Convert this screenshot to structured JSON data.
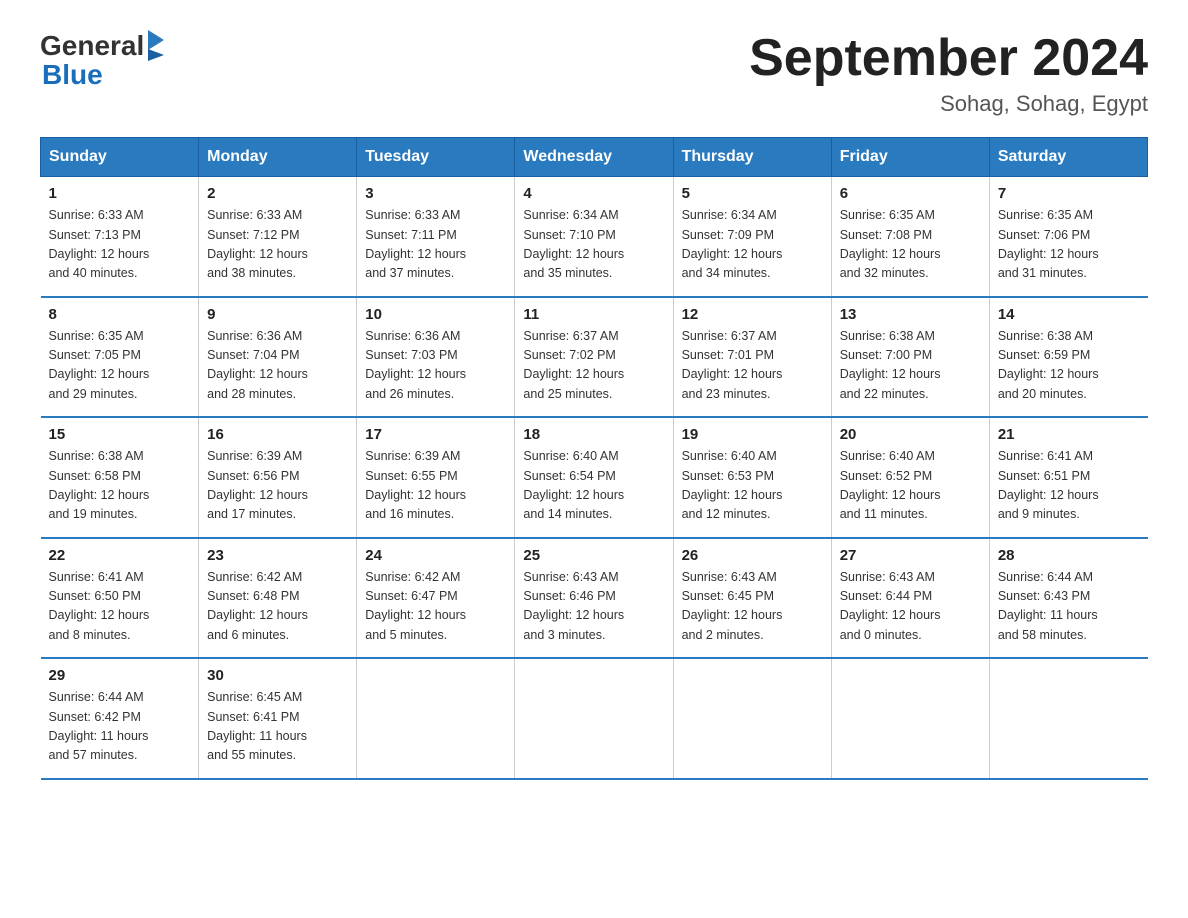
{
  "header": {
    "logo_general": "General",
    "logo_blue": "Blue",
    "title": "September 2024",
    "location": "Sohag, Sohag, Egypt"
  },
  "days_of_week": [
    "Sunday",
    "Monday",
    "Tuesday",
    "Wednesday",
    "Thursday",
    "Friday",
    "Saturday"
  ],
  "weeks": [
    [
      {
        "day": "1",
        "sunrise": "6:33 AM",
        "sunset": "7:13 PM",
        "daylight": "12 hours and 40 minutes."
      },
      {
        "day": "2",
        "sunrise": "6:33 AM",
        "sunset": "7:12 PM",
        "daylight": "12 hours and 38 minutes."
      },
      {
        "day": "3",
        "sunrise": "6:33 AM",
        "sunset": "7:11 PM",
        "daylight": "12 hours and 37 minutes."
      },
      {
        "day": "4",
        "sunrise": "6:34 AM",
        "sunset": "7:10 PM",
        "daylight": "12 hours and 35 minutes."
      },
      {
        "day": "5",
        "sunrise": "6:34 AM",
        "sunset": "7:09 PM",
        "daylight": "12 hours and 34 minutes."
      },
      {
        "day": "6",
        "sunrise": "6:35 AM",
        "sunset": "7:08 PM",
        "daylight": "12 hours and 32 minutes."
      },
      {
        "day": "7",
        "sunrise": "6:35 AM",
        "sunset": "7:06 PM",
        "daylight": "12 hours and 31 minutes."
      }
    ],
    [
      {
        "day": "8",
        "sunrise": "6:35 AM",
        "sunset": "7:05 PM",
        "daylight": "12 hours and 29 minutes."
      },
      {
        "day": "9",
        "sunrise": "6:36 AM",
        "sunset": "7:04 PM",
        "daylight": "12 hours and 28 minutes."
      },
      {
        "day": "10",
        "sunrise": "6:36 AM",
        "sunset": "7:03 PM",
        "daylight": "12 hours and 26 minutes."
      },
      {
        "day": "11",
        "sunrise": "6:37 AM",
        "sunset": "7:02 PM",
        "daylight": "12 hours and 25 minutes."
      },
      {
        "day": "12",
        "sunrise": "6:37 AM",
        "sunset": "7:01 PM",
        "daylight": "12 hours and 23 minutes."
      },
      {
        "day": "13",
        "sunrise": "6:38 AM",
        "sunset": "7:00 PM",
        "daylight": "12 hours and 22 minutes."
      },
      {
        "day": "14",
        "sunrise": "6:38 AM",
        "sunset": "6:59 PM",
        "daylight": "12 hours and 20 minutes."
      }
    ],
    [
      {
        "day": "15",
        "sunrise": "6:38 AM",
        "sunset": "6:58 PM",
        "daylight": "12 hours and 19 minutes."
      },
      {
        "day": "16",
        "sunrise": "6:39 AM",
        "sunset": "6:56 PM",
        "daylight": "12 hours and 17 minutes."
      },
      {
        "day": "17",
        "sunrise": "6:39 AM",
        "sunset": "6:55 PM",
        "daylight": "12 hours and 16 minutes."
      },
      {
        "day": "18",
        "sunrise": "6:40 AM",
        "sunset": "6:54 PM",
        "daylight": "12 hours and 14 minutes."
      },
      {
        "day": "19",
        "sunrise": "6:40 AM",
        "sunset": "6:53 PM",
        "daylight": "12 hours and 12 minutes."
      },
      {
        "day": "20",
        "sunrise": "6:40 AM",
        "sunset": "6:52 PM",
        "daylight": "12 hours and 11 minutes."
      },
      {
        "day": "21",
        "sunrise": "6:41 AM",
        "sunset": "6:51 PM",
        "daylight": "12 hours and 9 minutes."
      }
    ],
    [
      {
        "day": "22",
        "sunrise": "6:41 AM",
        "sunset": "6:50 PM",
        "daylight": "12 hours and 8 minutes."
      },
      {
        "day": "23",
        "sunrise": "6:42 AM",
        "sunset": "6:48 PM",
        "daylight": "12 hours and 6 minutes."
      },
      {
        "day": "24",
        "sunrise": "6:42 AM",
        "sunset": "6:47 PM",
        "daylight": "12 hours and 5 minutes."
      },
      {
        "day": "25",
        "sunrise": "6:43 AM",
        "sunset": "6:46 PM",
        "daylight": "12 hours and 3 minutes."
      },
      {
        "day": "26",
        "sunrise": "6:43 AM",
        "sunset": "6:45 PM",
        "daylight": "12 hours and 2 minutes."
      },
      {
        "day": "27",
        "sunrise": "6:43 AM",
        "sunset": "6:44 PM",
        "daylight": "12 hours and 0 minutes."
      },
      {
        "day": "28",
        "sunrise": "6:44 AM",
        "sunset": "6:43 PM",
        "daylight": "11 hours and 58 minutes."
      }
    ],
    [
      {
        "day": "29",
        "sunrise": "6:44 AM",
        "sunset": "6:42 PM",
        "daylight": "11 hours and 57 minutes."
      },
      {
        "day": "30",
        "sunrise": "6:45 AM",
        "sunset": "6:41 PM",
        "daylight": "11 hours and 55 minutes."
      },
      null,
      null,
      null,
      null,
      null
    ]
  ],
  "labels": {
    "sunrise": "Sunrise:",
    "sunset": "Sunset:",
    "daylight": "Daylight:"
  }
}
